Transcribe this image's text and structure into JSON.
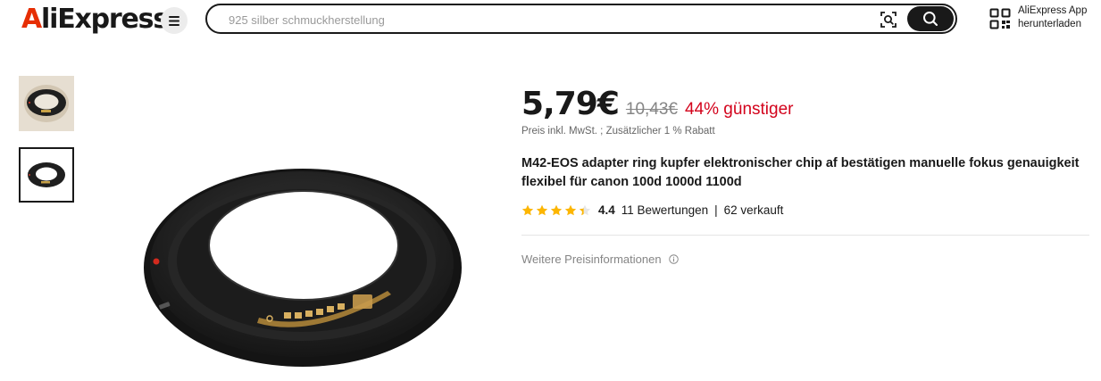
{
  "header": {
    "logo_accent": "A",
    "logo_rest": "liExpress",
    "menu_icon": "hamburger-menu-icon",
    "search": {
      "placeholder": "925 silber schmuckherstellung",
      "camera_icon": "image-search-icon",
      "search_icon": "search-icon"
    },
    "app_download": {
      "line1": "AliExpress App",
      "line2": "herunterladen",
      "icon": "qr-code-icon"
    }
  },
  "gallery": {
    "thumbnails": [
      {
        "icon": "product-thumbnail-photo",
        "selected": false
      },
      {
        "icon": "product-thumbnail-ring",
        "selected": true
      }
    ]
  },
  "product": {
    "price": "5,79€",
    "original_price": "10,43€",
    "discount": "44% günstiger",
    "tax_note": "Preis inkl. MwSt. ; Zusätzlicher 1 % Rabatt",
    "title": "M42-EOS adapter ring kupfer elektronischer chip af bestätigen manuelle fokus genauigkeit flexibel für canon 100d 1000d 1100d",
    "rating": {
      "score": "4.4",
      "stars": 4.4,
      "reviews": "11 Bewertungen",
      "separator": "|",
      "sold": "62 verkauft"
    },
    "more_price_info": "Weitere Preisinformationen"
  },
  "colors": {
    "accent_red": "#e62e04",
    "discount_red": "#d3031c",
    "star_yellow": "#fdb600",
    "text": "#191919",
    "muted": "#858585"
  }
}
